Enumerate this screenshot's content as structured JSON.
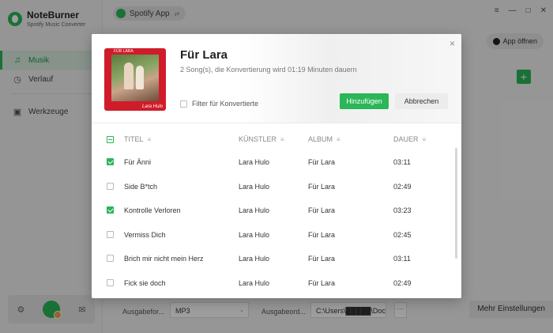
{
  "app": {
    "name": "NoteBurner",
    "subtitle": "Spotify Music Converter"
  },
  "sidebar": {
    "items": [
      {
        "label": "Musik",
        "icon": "headphones-icon",
        "active": true
      },
      {
        "label": "Verlauf",
        "icon": "clock-icon"
      },
      {
        "label": "Werkzeuge",
        "icon": "toolbox-icon"
      }
    ]
  },
  "topbar": {
    "source_label": "Spotify App",
    "window_controls": [
      "≡",
      "—",
      "□",
      "✕"
    ]
  },
  "main": {
    "app_open_label": "App öffnen",
    "add_label": "+"
  },
  "bottom_bar": {
    "format_label": "Ausgabefor...",
    "format_value": "MP3",
    "folder_label": "Ausgabeord...",
    "folder_value": "C:\\Users\\█████\\Docu",
    "more_label": "···",
    "settings_label": "Mehr Einstellungen"
  },
  "dialog": {
    "title": "Für Lara",
    "subtitle": "2 Song(s), die Konvertierung wird 01:19 Minuten dauern",
    "filter_label": "Filter für Konvertierte",
    "add_button": "Hinzufügen",
    "cancel_button": "Abbrechen",
    "close": "×",
    "cover_caption": "FÜR LARA",
    "cover_signature": "Lara Hulo",
    "columns": {
      "title": "TITEL",
      "artist": "KÜNSTLER",
      "album": "ALBUM",
      "duration": "DAUER"
    },
    "rows": [
      {
        "title": "Für Änni",
        "artist": "Lara Hulo",
        "album": "Für Lara",
        "duration": "03:11",
        "checked": true
      },
      {
        "title": "Side B*tch",
        "artist": "Lara Hulo",
        "album": "Für Lara",
        "duration": "02:49",
        "checked": false
      },
      {
        "title": "Kontrolle Verloren",
        "artist": "Lara Hulo",
        "album": "Für Lara",
        "duration": "03:23",
        "checked": true
      },
      {
        "title": "Vermiss Dich",
        "artist": "Lara Hulo",
        "album": "Für Lara",
        "duration": "02:45",
        "checked": false
      },
      {
        "title": "Brich mir nicht mein Herz",
        "artist": "Lara Hulo",
        "album": "Für Lara",
        "duration": "03:11",
        "checked": false
      },
      {
        "title": "Fick sie doch",
        "artist": "Lara Hulo",
        "album": "Für Lara",
        "duration": "02:49",
        "checked": false
      }
    ]
  },
  "colors": {
    "accent": "#2bb657",
    "cover": "#d01c2a"
  }
}
